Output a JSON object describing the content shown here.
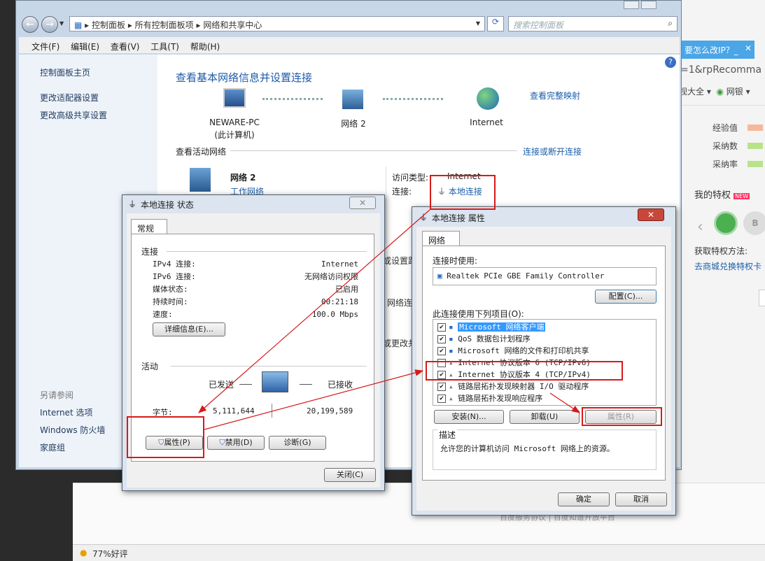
{
  "explorer": {
    "address": {
      "root": "控制面板",
      "mid": "所有控制面板项",
      "current": "网络和共享中心"
    },
    "search_placeholder": "搜索控制面板",
    "menu": [
      "文件(F)",
      "编辑(E)",
      "查看(V)",
      "工具(T)",
      "帮助(H)"
    ],
    "sidebar": {
      "home": "控制面板主页",
      "items": [
        "更改适配器设置",
        "更改高级共享设置"
      ],
      "see_also": "另请参阅",
      "see_also_items": [
        "Internet 选项",
        "Windows 防火墙",
        "家庭组"
      ]
    },
    "main": {
      "heading": "查看基本网络信息并设置连接",
      "full_map": "查看完整映射",
      "pc_name": "NEWARE-PC",
      "pc_sub": "(此计算机)",
      "network_node": "网络  2",
      "internet_node": "Internet",
      "active_networks": "查看活动网络",
      "connect_disconnect": "连接或断开连接",
      "network_name": "网络  2",
      "network_type": "工作网络",
      "access_type_label": "访问类型:",
      "access_type_value": "Internet",
      "connection_label": "连接:",
      "connection_value": "本地连接",
      "partial_1": "或设置路",
      "partial_2": "网络连",
      "partial_3": "或更改共"
    },
    "help_icon": "?"
  },
  "browser": {
    "tab_title": "要怎么改IP？_",
    "url_fragment": "=1&rpRecomma",
    "toolbar_1": "视大全",
    "toolbar_2": "网银",
    "stats": [
      "经验值",
      "采纳数",
      "采纳率"
    ],
    "privilege": "我的特权",
    "new_badge": "NEW",
    "get_method": "获取特权方法:",
    "exchange_link": "去商城兑换特权卡",
    "bottom_status": "77%好评",
    "bottom_link": "百度服务协议 | 百度知道开放平台"
  },
  "status_dialog": {
    "title": "本地连接 状态",
    "tab": "常规",
    "connection_section": "连接",
    "rows": [
      {
        "label": "IPv4 连接:",
        "value": "Internet"
      },
      {
        "label": "IPv6 连接:",
        "value": "无网络访问权限"
      },
      {
        "label": "媒体状态:",
        "value": "已启用"
      },
      {
        "label": "持续时间:",
        "value": "00:21:18"
      },
      {
        "label": "速度:",
        "value": "100.0 Mbps"
      }
    ],
    "details_button": "详细信息(E)...",
    "activity_section": "活动",
    "sent_label": "已发送",
    "received_label": "已接收",
    "bytes_label": "字节:",
    "bytes_sent": "5,111,644",
    "bytes_received": "20,199,589",
    "properties_button": "属性(P)",
    "disable_button": "禁用(D)",
    "diagnose_button": "诊断(G)",
    "close_button": "关闭(C)"
  },
  "props_dialog": {
    "title": "本地连接 属性",
    "tab": "网络",
    "connect_using_label": "连接时使用:",
    "adapter": "Realtek PCIe GBE Family Controller",
    "configure_button": "配置(C)...",
    "items_label": "此连接使用下列项目(O):",
    "items": [
      {
        "label": "Microsoft 网络客户端",
        "checked": true,
        "selected": true
      },
      {
        "label": "QoS 数据包计划程序",
        "checked": true,
        "selected": false
      },
      {
        "label": "Microsoft 网络的文件和打印机共享",
        "checked": true,
        "selected": false
      },
      {
        "label": "Internet 协议版本 6 (TCP/IPv6)",
        "checked": false,
        "selected": false
      },
      {
        "label": "Internet 协议版本 4 (TCP/IPv4)",
        "checked": true,
        "selected": false
      },
      {
        "label": "链路层拓扑发现映射器 I/O 驱动程序",
        "checked": true,
        "selected": false
      },
      {
        "label": "链路层拓扑发现响应程序",
        "checked": true,
        "selected": false
      }
    ],
    "install_button": "安装(N)...",
    "uninstall_button": "卸载(U)",
    "properties_button": "属性(R)",
    "description_label": "描述",
    "description": "允许您的计算机访问 Microsoft 网络上的资源。",
    "ok_button": "确定",
    "cancel_button": "取消",
    "close_x": "✕"
  },
  "colors": {
    "accent_red": "#d61a1a",
    "link": "#1a5ea9",
    "heading": "#1e5aa8",
    "selection": "#3399ff"
  }
}
